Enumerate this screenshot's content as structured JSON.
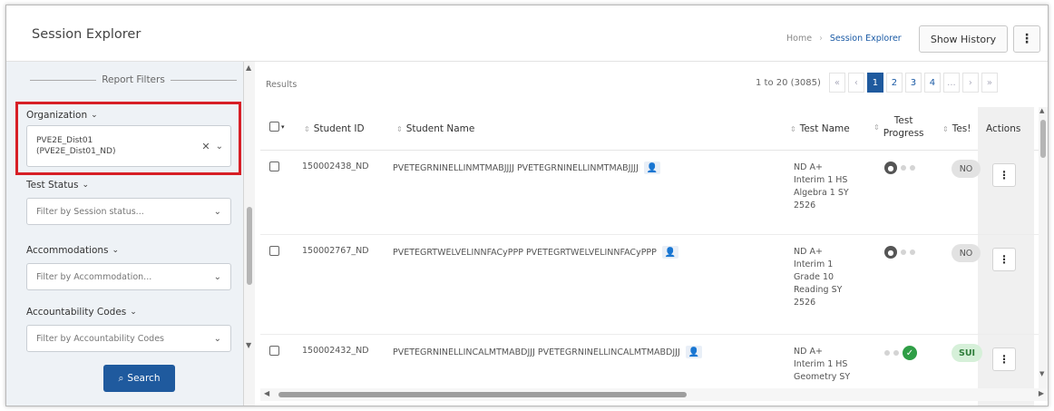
{
  "header": {
    "title": "Session Explorer",
    "breadcrumb": [
      "Home",
      "Session Explorer"
    ],
    "show_history": "Show History",
    "more_icon": "⋮"
  },
  "filters": {
    "title": "Report Filters",
    "organization": {
      "label": "Organization",
      "value_line1": "PVE2E_Dist01",
      "value_line2": "(PVE2E_Dist01_ND)"
    },
    "test_status": {
      "label": "Test Status",
      "placeholder": "Filter by Session status..."
    },
    "accommodations": {
      "label": "Accommodations",
      "placeholder": "Filter by Accommodation..."
    },
    "accountability": {
      "label": "Accountability Codes",
      "placeholder": "Filter by Accountability Codes"
    },
    "search_button": "Search"
  },
  "results": {
    "label": "Results",
    "range": "1 to 20 (3085)",
    "pages": [
      "1",
      "2",
      "3",
      "4",
      "..."
    ],
    "current_page": "1"
  },
  "columns": {
    "student_id": "Student ID",
    "student_name": "Student Name",
    "test_name": "Test Name",
    "test_progress_1": "Test",
    "test_progress_2": "Progress",
    "test_status": "Tes!",
    "actions": "Actions"
  },
  "rows": [
    {
      "id": "150002438_ND",
      "name": "PVETEGRNINELLINMTMABJJJJ PVETEGRNINELLINMTMABJJJJ",
      "test": [
        "ND A+",
        "Interim 1 HS",
        "Algebra 1 SY",
        "2526"
      ],
      "status": "NO"
    },
    {
      "id": "150002767_ND",
      "name": "PVETEGRTWELVELINNFACyPPP PVETEGRTWELVELINNFACyPPP",
      "test": [
        "ND A+",
        "Interim 1",
        "Grade 10",
        "Reading SY",
        "2526"
      ],
      "status": "NO"
    },
    {
      "id": "150002432_ND",
      "name": "PVETEGRNINELLINCALMTMABDJJJ PVETEGRNINELLINCALMTMABDJJJ",
      "test": [
        "ND A+",
        "Interim 1 HS",
        "Geometry SY"
      ],
      "status": "SUI"
    }
  ],
  "colors": {
    "primary": "#1f5a9e",
    "highlight": "#d71f26",
    "success": "#2f9e46"
  }
}
